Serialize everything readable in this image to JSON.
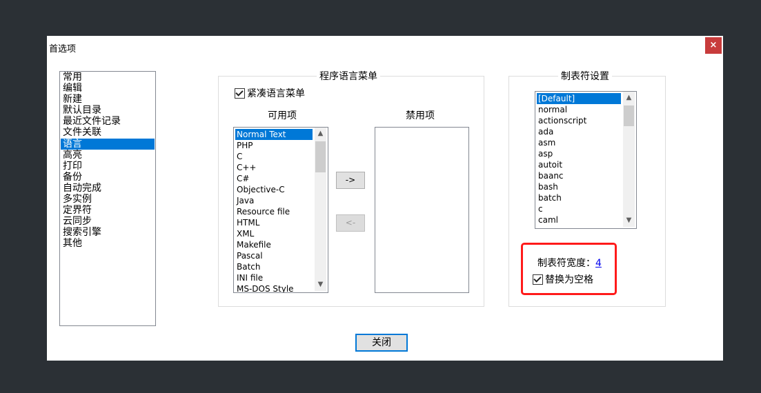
{
  "window": {
    "title": "首选项",
    "close_glyph": "×"
  },
  "categories": {
    "items": [
      "常用",
      "编辑",
      "新建",
      "默认目录",
      "最近文件记录",
      "文件关联",
      "语言",
      "高亮",
      "打印",
      "备份",
      "自动完成",
      "多实例",
      "定界符",
      "云同步",
      "搜索引擎",
      "其他"
    ],
    "selected": "语言"
  },
  "language_menu": {
    "group_title": "程序语言菜单",
    "compact_label": "紧凑语言菜单",
    "compact_checked": true,
    "available_header": "可用项",
    "disabled_header": "禁用项",
    "available_items": [
      "Normal Text",
      "PHP",
      "C",
      "C++",
      "C#",
      "Objective-C",
      "Java",
      "Resource file",
      "HTML",
      "XML",
      "Makefile",
      "Pascal",
      "Batch",
      "INI file",
      "MS-DOS Style"
    ],
    "available_selected": "Normal Text",
    "disabled_items": [],
    "move_right_label": "->",
    "move_left_label": "<-"
  },
  "tab_settings": {
    "group_title": "制表符设置",
    "languages": [
      "[Default]",
      "normal",
      "actionscript",
      "ada",
      "asm",
      "asp",
      "autoit",
      "baanc",
      "bash",
      "batch",
      "c",
      "caml"
    ],
    "selected": "[Default]",
    "width_label": "制表符宽度：",
    "width_value": "4",
    "replace_label": "替换为空格",
    "replace_checked": true,
    "highlight_color": "#ff1a1a"
  },
  "footer": {
    "close_label": "关闭"
  },
  "colors": {
    "accent": "#0078d7",
    "close_button": "#c83c3c",
    "background": "#2b3035"
  }
}
